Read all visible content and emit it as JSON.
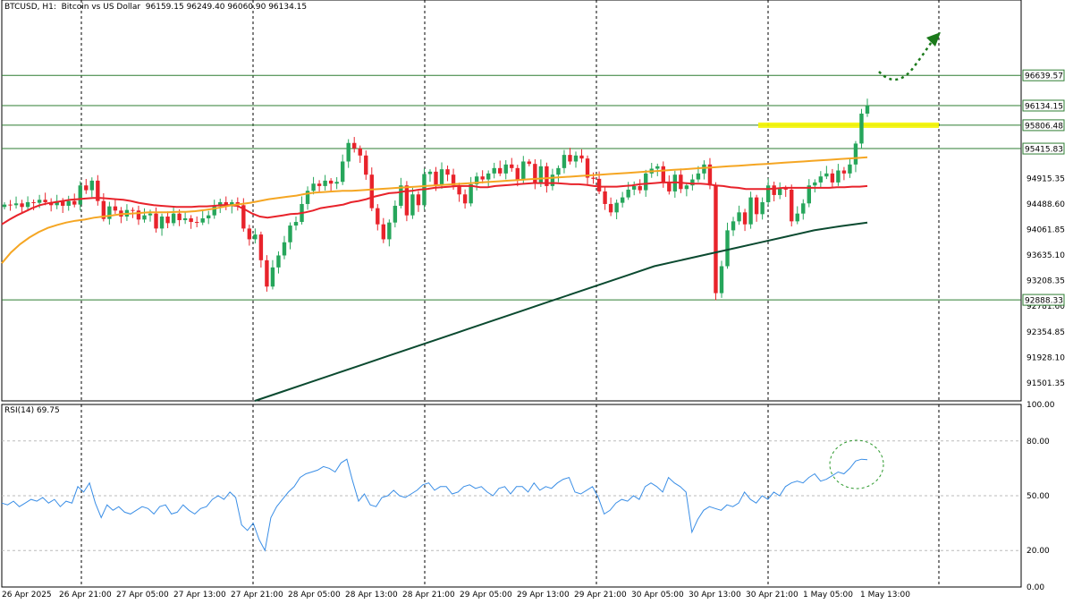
{
  "header": {
    "symbol_text": "BTCUSD, H1:  Bitcoin vs US Dollar",
    "ohlc_text": "96159.15 96249.40 96060.90 96134.15"
  },
  "rsi_header": "RSI(14) 69.75",
  "colors": {
    "up": "#26a65b",
    "down": "#e8232b",
    "ma_fast": "#e8232b",
    "ma_mid": "#f5a623",
    "ma_slow": "#0b4a30",
    "level": "#2e7d32",
    "highlight": "#f5f500",
    "rsi": "#3a8ee6",
    "grid": "#000000"
  },
  "chart_data": [
    {
      "type": "candlestick",
      "title": "BTCUSD, H1: Bitcoin vs US Dollar",
      "ylim": [
        91200,
        97450
      ],
      "y_ticks": [
        "96639.57",
        "96134.15",
        "95806.48",
        "95415.83",
        "94915.35",
        "94488.60",
        "94061.85",
        "93635.10",
        "93208.35",
        "92888.33",
        "92781.60",
        "92354.85",
        "91928.10",
        "91501.35"
      ],
      "x_ticks": [
        "26 Apr 2025",
        "26 Apr 21:00",
        "27 Apr 05:00",
        "27 Apr 13:00",
        "27 Apr 21:00",
        "28 Apr 05:00",
        "28 Apr 13:00",
        "28 Apr 21:00",
        "29 Apr 05:00",
        "29 Apr 13:00",
        "29 Apr 21:00",
        "30 Apr 05:00",
        "30 Apr 13:00",
        "30 Apr 21:00",
        "1 May 05:00",
        "1 May 13:00"
      ],
      "horizontal_levels": [
        96639.57,
        96134.15,
        95806.48,
        95415.83,
        92888.33
      ],
      "highlighted_level": 95806.48,
      "close_series": [
        94480,
        94470,
        94500,
        94440,
        94520,
        94510,
        94560,
        94520,
        94470,
        94540,
        94460,
        94540,
        94480,
        94800,
        94720,
        94880,
        94540,
        94240,
        94450,
        94380,
        94280,
        94390,
        94380,
        94230,
        94300,
        94330,
        94080,
        94280,
        94170,
        94330,
        94220,
        94250,
        94190,
        94180,
        94250,
        94300,
        94450,
        94520,
        94460,
        94520,
        94470,
        94080,
        93900,
        93980,
        93550,
        93110,
        93430,
        93630,
        93850,
        94130,
        94190,
        94490,
        94710,
        94830,
        94790,
        94880,
        94830,
        94860,
        95200,
        95510,
        95420,
        95300,
        94980,
        94420,
        94150,
        93900,
        94180,
        94460,
        94800,
        94300,
        94650,
        94470,
        94990,
        95030,
        94800,
        95070,
        94980,
        94800,
        94650,
        94500,
        94820,
        94950,
        94900,
        95000,
        95090,
        95000,
        95150,
        95090,
        94900,
        95200,
        95160,
        94830,
        95120,
        94790,
        94980,
        95090,
        95310,
        95200,
        95300,
        95250,
        94930,
        94910,
        94700,
        94490,
        94350,
        94510,
        94600,
        94730,
        94790,
        94720,
        95000,
        95080,
        95120,
        94850,
        94700,
        94980,
        94740,
        94800,
        94900,
        95000,
        95150,
        94800,
        93000,
        93450,
        94050,
        94200,
        94350,
        94150,
        94600,
        94320,
        94520,
        94800,
        94640,
        94750,
        94730,
        94200,
        94330,
        94500,
        94800,
        94850,
        94950,
        95000,
        94850,
        95050,
        95000,
        95150,
        95500,
        96000,
        96134.15
      ],
      "series": [
        {
          "name": "MA fast",
          "values": [
            94150,
            94230,
            94300,
            94360,
            94420,
            94470,
            94500,
            94520,
            94540,
            94560,
            94570,
            94580,
            94590,
            94590,
            94580,
            94570,
            94560,
            94540,
            94510,
            94490,
            94470,
            94460,
            94450,
            94440,
            94440,
            94440,
            94450,
            94450,
            94460,
            94470,
            94470,
            94460,
            94400,
            94330,
            94280,
            94260,
            94280,
            94300,
            94320,
            94330,
            94350,
            94380,
            94420,
            94440,
            94460,
            94480,
            94520,
            94540,
            94570,
            94610,
            94640,
            94670,
            94680,
            94700,
            94710,
            94730,
            94740,
            94760,
            94770,
            94780,
            94790,
            94790,
            94790,
            94770,
            94770,
            94790,
            94800,
            94810,
            94820,
            94830,
            94840,
            94840,
            94840,
            94840,
            94830,
            94820,
            94820,
            94810,
            94790,
            94780,
            94780,
            94780,
            94790,
            94800,
            94820,
            94830,
            94840,
            94850,
            94850,
            94850,
            94840,
            94830,
            94830,
            94820,
            94800,
            94790,
            94770,
            94760,
            94740,
            94740,
            94740,
            94740,
            94750,
            94760,
            94760,
            94760,
            94760,
            94760,
            94760,
            94760,
            94770,
            94770,
            94780,
            94780,
            94790
          ]
        },
        {
          "name": "MA mid",
          "values": [
            93500,
            93680,
            93820,
            93930,
            94020,
            94090,
            94140,
            94180,
            94210,
            94230,
            94260,
            94280,
            94300,
            94320,
            94330,
            94340,
            94350,
            94350,
            94350,
            94360,
            94360,
            94370,
            94390,
            94410,
            94440,
            94470,
            94490,
            94510,
            94540,
            94570,
            94590,
            94610,
            94630,
            94660,
            94680,
            94690,
            94700,
            94710,
            94710,
            94720,
            94730,
            94740,
            94750,
            94760,
            94770,
            94780,
            94790,
            94800,
            94810,
            94820,
            94830,
            94840,
            94850,
            94860,
            94870,
            94880,
            94890,
            94900,
            94910,
            94920,
            94930,
            94940,
            94950,
            94960,
            94970,
            94980,
            94990,
            95000,
            95010,
            95020,
            95030,
            95040,
            95050,
            95060,
            95070,
            95080,
            95090,
            95100,
            95110,
            95120,
            95130,
            95140,
            95150,
            95160,
            95170,
            95180,
            95190,
            95200,
            95210,
            95220,
            95230,
            95240,
            95250,
            95260,
            95270
          ]
        },
        {
          "name": "MA slow",
          "values": [
            91200,
            91350,
            91500,
            91650,
            91800,
            91950,
            92100,
            92250,
            92400,
            92550,
            92700,
            92850,
            93000,
            93150,
            93300,
            93450,
            93550,
            93650,
            93750,
            93850,
            93950,
            94050,
            94120,
            94180
          ]
        }
      ]
    },
    {
      "type": "line",
      "title": "RSI(14) 69.75",
      "ylim": [
        0,
        100
      ],
      "y_ticks": [
        "100.00",
        "80.00",
        "50.00",
        "20.00",
        "0.00"
      ],
      "series": [
        {
          "name": "RSI(14)",
          "values": [
            46,
            45,
            47,
            44,
            46,
            48,
            47,
            49,
            46,
            48,
            44,
            47,
            46,
            55,
            52,
            57,
            46,
            38,
            45,
            42,
            44,
            41,
            40,
            42,
            44,
            43,
            40,
            44,
            45,
            40,
            41,
            45,
            42,
            40,
            43,
            44,
            48,
            50,
            48,
            52,
            49,
            34,
            31,
            35,
            26,
            20,
            38,
            44,
            48,
            52,
            55,
            60,
            62,
            63,
            64,
            66,
            65,
            63,
            68,
            70,
            58,
            47,
            51,
            45,
            44,
            49,
            50,
            53,
            50,
            49,
            51,
            53,
            56,
            57,
            53,
            55,
            55,
            51,
            52,
            55,
            56,
            54,
            55,
            52,
            50,
            54,
            55,
            51,
            55,
            55,
            52,
            57,
            53,
            55,
            54,
            57,
            59,
            60,
            52,
            51,
            53,
            55,
            49,
            40,
            42,
            46,
            48,
            47,
            50,
            48,
            55,
            57,
            55,
            52,
            60,
            57,
            55,
            52,
            30,
            37,
            42,
            44,
            43,
            42,
            45,
            44,
            46,
            52,
            48,
            46,
            50,
            48,
            52,
            50,
            55,
            57,
            58,
            57,
            60,
            62,
            58,
            59,
            61,
            63,
            62,
            65,
            69,
            70,
            69.75
          ]
        }
      ]
    }
  ]
}
